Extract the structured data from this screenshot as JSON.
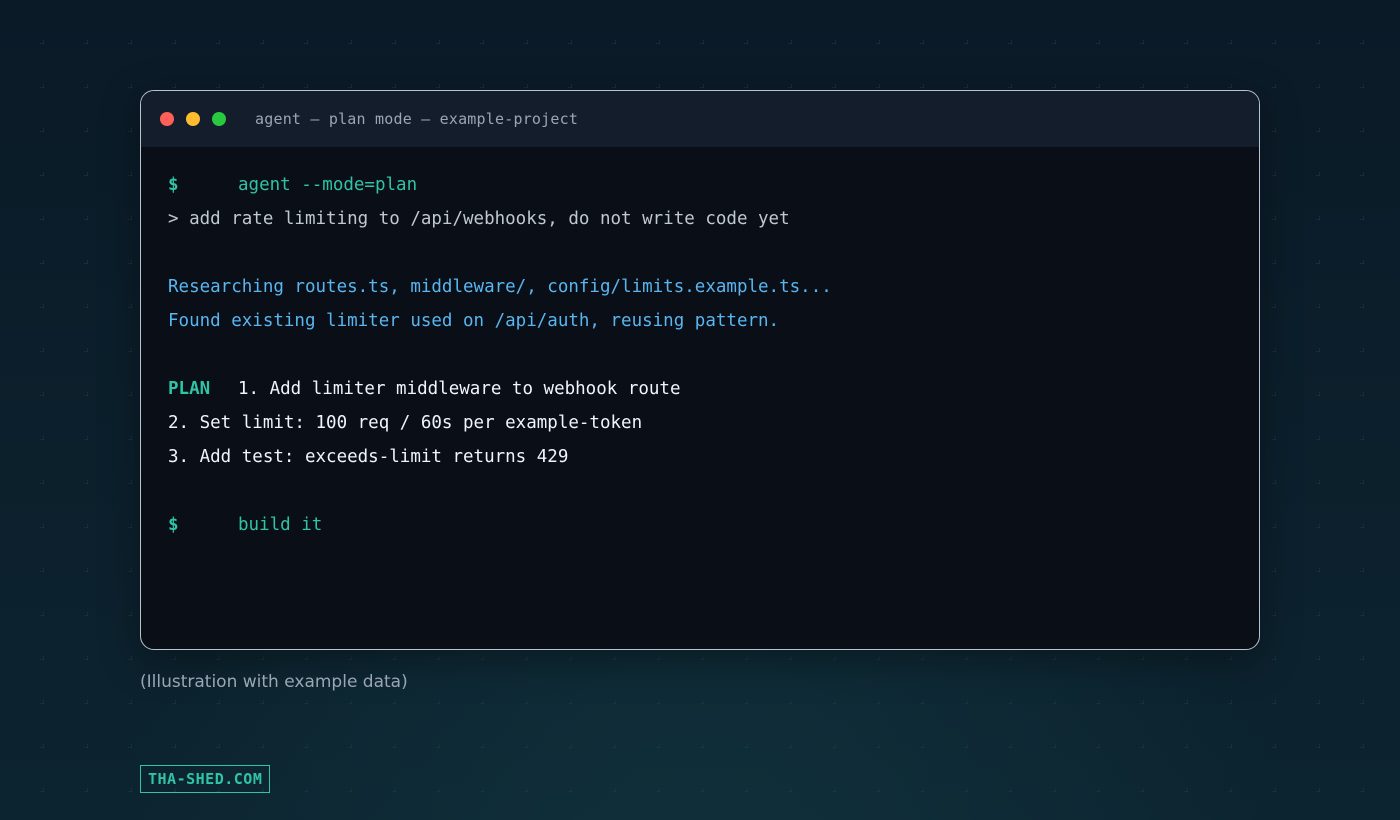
{
  "window": {
    "title": "agent — plan mode — example-project",
    "controls": [
      "close",
      "minimize",
      "maximize"
    ]
  },
  "terminal": {
    "prompt_symbol": "$",
    "command_1": "agent --mode=plan",
    "user_request": "> add rate limiting to /api/webhooks, do not write code yet",
    "research_1": "Researching routes.ts, middleware/, config/limits.example.ts...",
    "research_2": "Found existing limiter used on /api/auth, reusing pattern.",
    "plan_label": "PLAN",
    "plan_steps": [
      "1. Add limiter middleware to webhook route",
      "2. Set limit: 100 req / 60s per example-token",
      "3. Add test: exceeds-limit returns 429"
    ],
    "command_2": "build it"
  },
  "caption": "(Illustration with example data)",
  "brand": "THA-SHED.COM",
  "colors": {
    "accent": "#2fc4a6",
    "info": "#58b6f0",
    "terminal_bg": "#0a0e17",
    "titlebar_bg": "#141d2b",
    "page_bg": "#0b1d2a",
    "close": "#ff5f57",
    "minimize": "#febc2e",
    "maximize": "#28c840"
  }
}
